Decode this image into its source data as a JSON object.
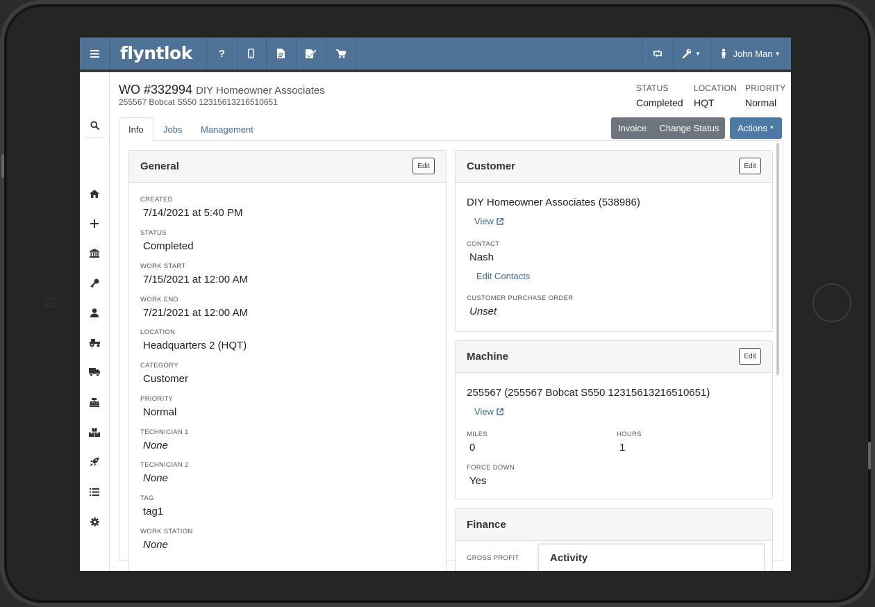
{
  "navbar": {
    "logo": "flyntlok",
    "user_name": "John Man"
  },
  "header": {
    "wo_number": "WO #332994",
    "customer_name": "DIY Homeowner Associates",
    "machine_line": "255567 Bobcat S550 12315613216510651",
    "status_label": "STATUS",
    "status_value": "Completed",
    "location_label": "LOCATION",
    "location_value": "HQT",
    "priority_label": "PRIORITY",
    "priority_value": "Normal"
  },
  "tabs": [
    "Info",
    "Jobs",
    "Management"
  ],
  "buttons": {
    "invoice": "Invoice",
    "change_status": "Change Status",
    "actions": "Actions"
  },
  "general": {
    "title": "General",
    "edit": "Edit",
    "fields": [
      {
        "label": "CREATED",
        "value": "7/14/2021 at 5:40 PM"
      },
      {
        "label": "STATUS",
        "value": "Completed"
      },
      {
        "label": "WORK START",
        "value": "7/15/2021 at 12:00 AM"
      },
      {
        "label": "WORK END",
        "value": "7/21/2021 at 12:00 AM"
      },
      {
        "label": "LOCATION",
        "value": "Headquarters 2 (HQT)"
      },
      {
        "label": "CATEGORY",
        "value": "Customer"
      },
      {
        "label": "PRIORITY",
        "value": "Normal"
      },
      {
        "label": "TECHNICIAN 1",
        "value": "None"
      },
      {
        "label": "TECHNICIAN 2",
        "value": "None"
      },
      {
        "label": "TAG",
        "value": "tag1"
      },
      {
        "label": "WORK STATION",
        "value": "None"
      }
    ]
  },
  "customer": {
    "title": "Customer",
    "edit": "Edit",
    "name": "DIY Homeowner Associates (538986)",
    "view": "View",
    "contact_label": "CONTACT",
    "contact_value": "Nash",
    "edit_contacts": "Edit Contacts",
    "po_label": "CUSTOMER PURCHASE ORDER",
    "po_value": "Unset"
  },
  "machine": {
    "title": "Machine",
    "edit": "Edit",
    "name": "255567 (255567 Bobcat S550 12315613216510651)",
    "view": "View",
    "miles_label": "MILES",
    "miles_value": "0",
    "hours_label": "HOURS",
    "hours_value": "1",
    "force_down_label": "FORCE DOWN",
    "force_down_value": "Yes"
  },
  "finance": {
    "title": "Finance",
    "gross_profit_label": "GROSS PROFIT"
  },
  "activity": {
    "title": "Activity"
  }
}
